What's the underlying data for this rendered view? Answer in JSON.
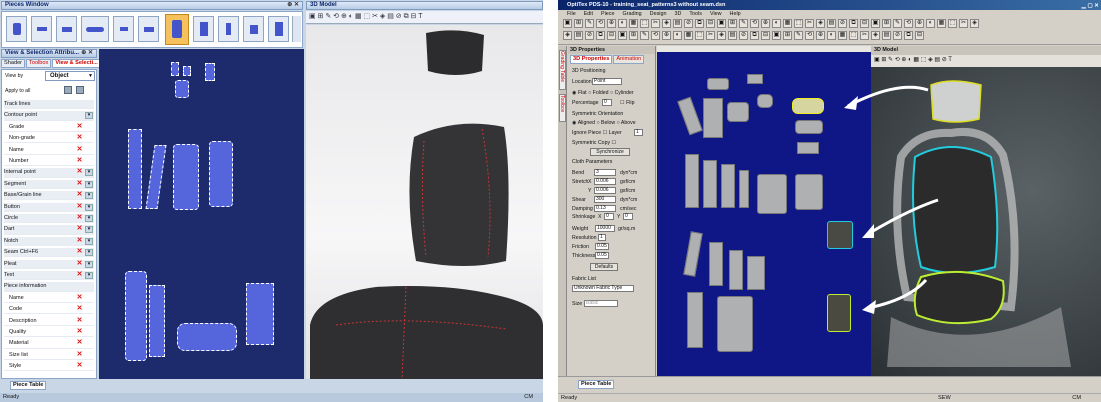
{
  "left": {
    "pieces_window_title": "Pieces Window",
    "view_panel_title": "View & Selection Attribu...",
    "tabs": [
      "Shader",
      "Toolbox",
      "View & Selecti..."
    ],
    "view_by_label": "View by",
    "view_by_value": "Object",
    "apply_all": "Apply to all",
    "rows": [
      {
        "label": "Track lines",
        "x": false,
        "dd": false,
        "sec": true
      },
      {
        "label": "Contour point",
        "x": false,
        "dd": true,
        "sec": true
      },
      {
        "label": "Grade",
        "x": true,
        "dd": false,
        "ind": true
      },
      {
        "label": "Non-grade",
        "x": true,
        "dd": false,
        "ind": true
      },
      {
        "label": "Name",
        "x": true,
        "dd": false,
        "ind": true
      },
      {
        "label": "Number",
        "x": true,
        "dd": false,
        "ind": true
      },
      {
        "label": "Internal point",
        "x": true,
        "dd": true,
        "sec": true
      },
      {
        "label": "Segment",
        "x": true,
        "dd": true,
        "sec": true
      },
      {
        "label": "Base/Grain line",
        "x": true,
        "dd": true,
        "sec": true
      },
      {
        "label": "Button",
        "x": true,
        "dd": true,
        "sec": true
      },
      {
        "label": "Circle",
        "x": true,
        "dd": true,
        "sec": true
      },
      {
        "label": "Dart",
        "x": true,
        "dd": true,
        "sec": true
      },
      {
        "label": "Notch",
        "x": true,
        "dd": true,
        "sec": true
      },
      {
        "label": "Seam Ctrl+F6",
        "x": true,
        "dd": true,
        "sec": true
      },
      {
        "label": "Pleat",
        "x": true,
        "dd": true,
        "sec": true
      },
      {
        "label": "Text",
        "x": true,
        "dd": true,
        "sec": true
      },
      {
        "label": "Piece information",
        "x": false,
        "dd": false,
        "sec": true
      },
      {
        "label": "Name",
        "x": true,
        "dd": false,
        "ind": true
      },
      {
        "label": "Code",
        "x": true,
        "dd": false,
        "ind": true
      },
      {
        "label": "Description",
        "x": true,
        "dd": false,
        "ind": true
      },
      {
        "label": "Quality",
        "x": true,
        "dd": false,
        "ind": true
      },
      {
        "label": "Material",
        "x": true,
        "dd": false,
        "ind": true
      },
      {
        "label": "Size list",
        "x": true,
        "dd": false,
        "ind": true
      },
      {
        "label": "Style",
        "x": true,
        "dd": false,
        "ind": true
      }
    ],
    "model_title": "3D Model",
    "piece_table_tab": "Piece Table",
    "status_left": "Ready",
    "status_right": "CM"
  },
  "right": {
    "app_title": "OptiTex PDS-10 - training_seat_patterns3 without seam.dsn",
    "menu": [
      "File",
      "Edit",
      "Piece",
      "Grading",
      "Design",
      "3D",
      "Tools",
      "View",
      "Help"
    ],
    "props_title": "3D Properties",
    "props_tabs": [
      "3D Properties",
      "Animation"
    ],
    "side_tabs": [
      "Grading Table",
      "Toolbox"
    ],
    "positioning": "3D Positioning",
    "location_label": "Location",
    "location_value": "Point",
    "flat": "Flat",
    "folded": "Folded",
    "cylinder": "Cylinder",
    "percentage": "Percentage",
    "pct_val": "0",
    "flip": "Flip",
    "sym_orient": "Symmetric Orientation",
    "aligned": "Aligned",
    "below": "Below",
    "above": "Above",
    "ignore_piece": "Ignore Piece",
    "layer": "Layer",
    "layer_val": "1",
    "sym_copy": "Symmetric Copy",
    "sync": "Synchronize",
    "cloth_params": "Cloth Parameters",
    "params": [
      {
        "label": "Bend",
        "axis": "",
        "val": "3",
        "unit": "dyn*cm"
      },
      {
        "label": "Stretch",
        "axis": "X",
        "val": "0.006",
        "unit": "gsf/cm"
      },
      {
        "label": "",
        "axis": "Y",
        "val": "0.006",
        "unit": "gsf/cm"
      },
      {
        "label": "Shear",
        "axis": "",
        "val": "300",
        "unit": "dyn*cm"
      },
      {
        "label": "Damping",
        "axis": "",
        "val": "0.13",
        "unit": "cm/sec"
      }
    ],
    "shrinkage": "Shrinkage",
    "shr_x": "0",
    "shr_y": "0",
    "weight": "Weight",
    "weight_val": "10000",
    "weight_unit": "gr/sq.m",
    "resolution": "Resolution",
    "res_val": "1",
    "friction": "Friction",
    "fric_val": "0.05",
    "thickness": "Thickness",
    "thick_val": "0.05",
    "defaults": "Defaults",
    "fabric_list": "Fabric List",
    "fabric_value": "Unknown Fabric Type",
    "size_label": "Size",
    "size_value": "Basic",
    "model_title": "3D Model",
    "piece_table_tab": "Piece Table",
    "status_left": "Ready",
    "status_mid": "SEW",
    "status_right": "CM"
  }
}
